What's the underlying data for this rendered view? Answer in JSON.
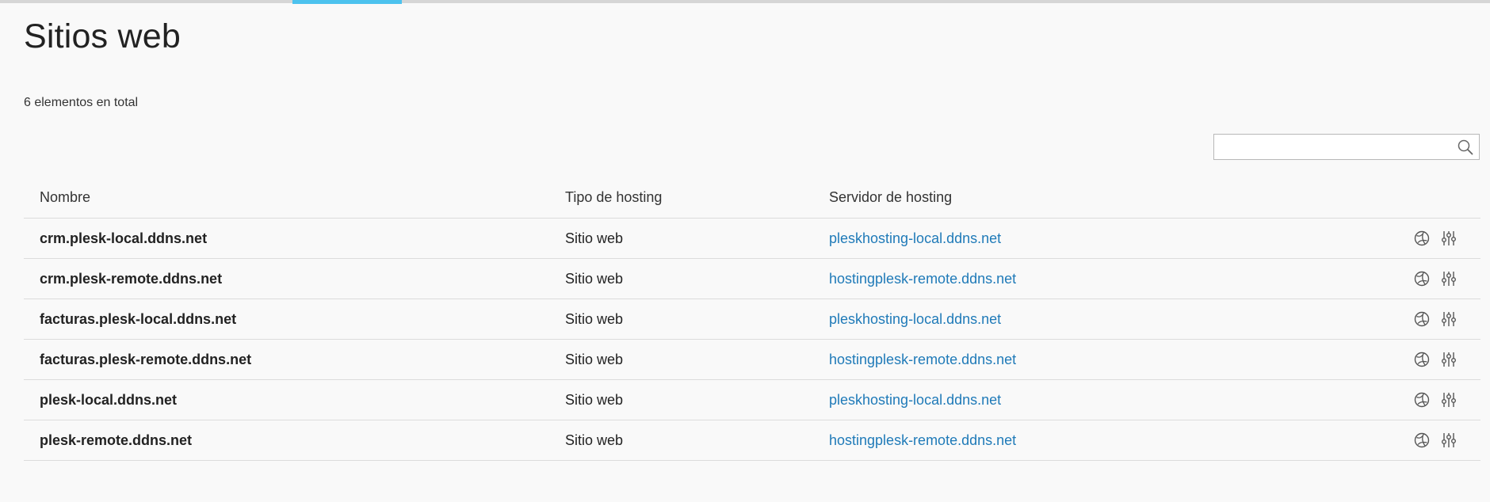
{
  "page": {
    "title": "Sitios web",
    "total_text": "6 elementos en total"
  },
  "search": {
    "value": "",
    "placeholder": ""
  },
  "table": {
    "headers": {
      "name": "Nombre",
      "type": "Tipo de hosting",
      "server": "Servidor de hosting"
    },
    "rows": [
      {
        "name": "crm.plesk-local.ddns.net",
        "type": "Sitio web",
        "server": "pleskhosting-local.ddns.net"
      },
      {
        "name": "crm.plesk-remote.ddns.net",
        "type": "Sitio web",
        "server": "hostingplesk-remote.ddns.net"
      },
      {
        "name": "facturas.plesk-local.ddns.net",
        "type": "Sitio web",
        "server": "pleskhosting-local.ddns.net"
      },
      {
        "name": "facturas.plesk-remote.ddns.net",
        "type": "Sitio web",
        "server": "hostingplesk-remote.ddns.net"
      },
      {
        "name": "plesk-local.ddns.net",
        "type": "Sitio web",
        "server": "pleskhosting-local.ddns.net"
      },
      {
        "name": "plesk-remote.ddns.net",
        "type": "Sitio web",
        "server": "hostingplesk-remote.ddns.net"
      }
    ],
    "row_actions": [
      "globe-icon",
      "sliders-icon"
    ]
  },
  "colors": {
    "accent_tab": "#4cc2ee",
    "link": "#1f7ab8",
    "background": "#f9f9f9"
  }
}
